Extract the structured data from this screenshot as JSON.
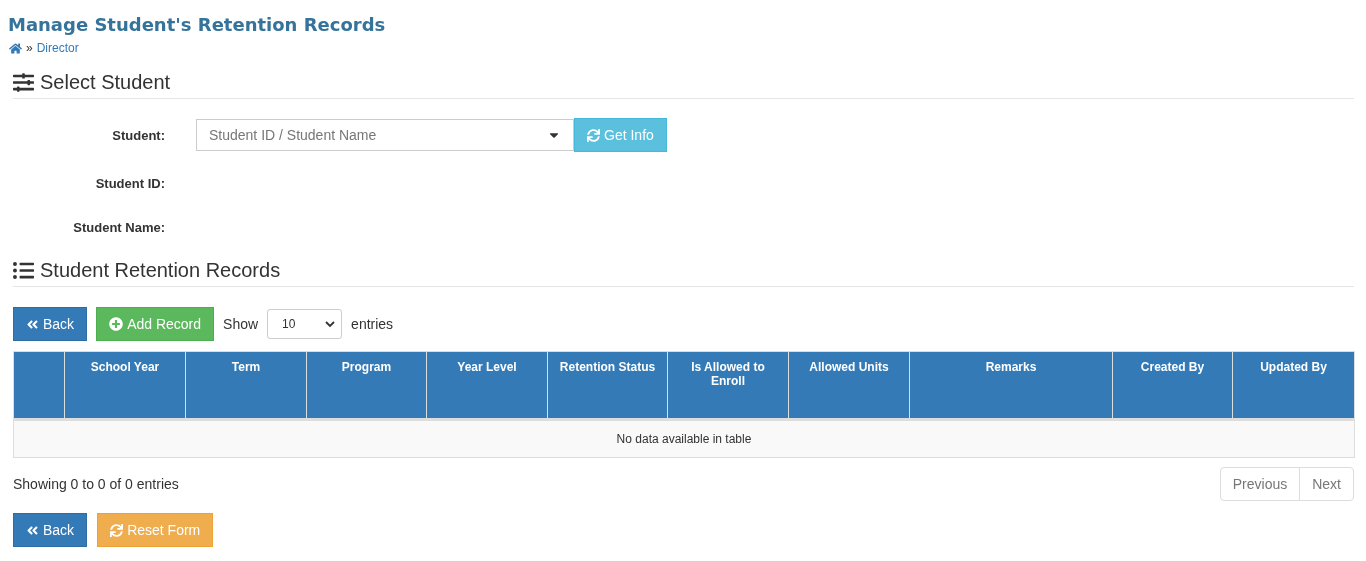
{
  "page_title": "Manage Student's Retention Records",
  "breadcrumb": {
    "separator": "»",
    "link": "Director"
  },
  "select_section": {
    "title": "Select Student",
    "student_field": {
      "label": "Student:",
      "placeholder": "Student ID / Student Name"
    },
    "get_info_button": "Get Info",
    "info_rows": [
      {
        "label": "Student ID:"
      },
      {
        "label": "Student Name:"
      }
    ]
  },
  "records_section": {
    "title": "Student Retention Records",
    "toolbar": {
      "back_button": "Back",
      "add_button": "Add Record",
      "show_label": "Show",
      "page_size": "10",
      "entries_label": "entries"
    },
    "table": {
      "columns": [
        "School Year",
        "Term",
        "Program",
        "Year Level",
        "Retention Status",
        "Is Allowed to Enroll",
        "Allowed Units",
        "Remarks",
        "Created By",
        "Updated By"
      ],
      "empty_message": "No data available in table"
    },
    "info": "Showing 0 to 0 of 0 entries",
    "pagination": [
      {
        "label": "Previous",
        "disabled": true
      },
      {
        "label": "Next",
        "disabled": true
      }
    ]
  },
  "footer_buttons": [
    {
      "kind": "back",
      "label": "Back"
    },
    {
      "kind": "reset",
      "label": "Reset Form"
    }
  ]
}
